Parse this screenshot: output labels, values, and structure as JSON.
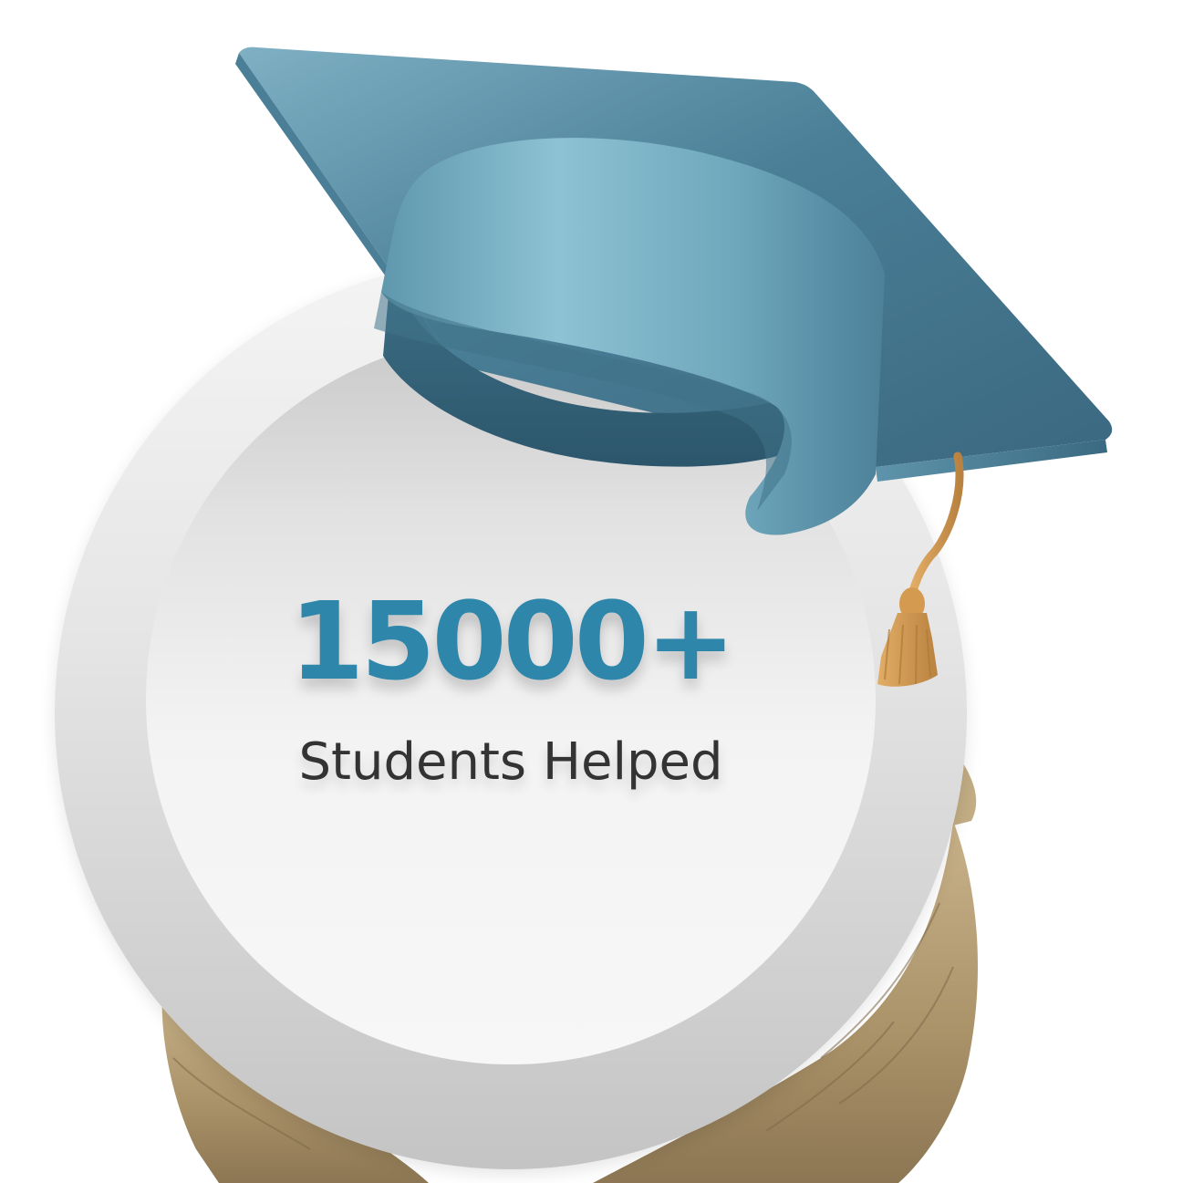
{
  "stat": {
    "value": "15000+",
    "label": "Students Helped"
  },
  "colors": {
    "value_text": "#2e86ab",
    "label_text": "#333333",
    "cap_light": "#86bccd",
    "cap_dark": "#3c6a80",
    "tassel": "#d9a25a",
    "skin": "#b9a27a"
  },
  "icons": {
    "cap": "graduation-cap-icon",
    "hands": "open-hands-image"
  }
}
